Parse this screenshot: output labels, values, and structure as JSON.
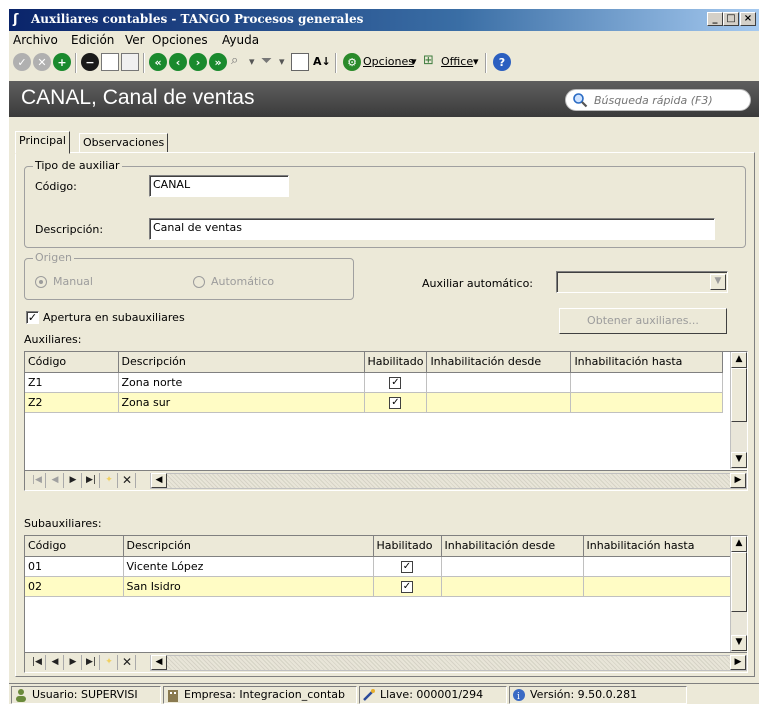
{
  "window": {
    "title": "Auxiliares contables - TANGO Procesos generales",
    "min": "_",
    "max": "□",
    "close": "×"
  },
  "menu": {
    "archivo": "Archivo",
    "edicion": "Edición",
    "ver": "Ver",
    "opciones": "Opciones",
    "ayuda": "Ayuda"
  },
  "toolbar": {
    "opciones_label": "Opciones",
    "office_label": "Office"
  },
  "header": {
    "title": "CANAL, Canal de ventas",
    "search_placeholder": "Búsqueda rápida (F3)"
  },
  "tabs": [
    {
      "label": "Principal"
    },
    {
      "label": "Observaciones"
    }
  ],
  "tipo_auxiliar": {
    "legend": "Tipo de auxiliar",
    "codigo_label": "Código:",
    "codigo_value": "CANAL",
    "descripcion_label": "Descripción:",
    "descripcion_value": "Canal de ventas"
  },
  "origen": {
    "legend": "Origen",
    "manual": "Manual",
    "automatico": "Automático"
  },
  "auxiliar_automatico_label": "Auxiliar automático:",
  "obtener_button": "Obtener auxiliares...",
  "apertura_label": "Apertura en subauxiliares",
  "auxiliares": {
    "label": "Auxiliares:",
    "columns": [
      "Código",
      "Descripción",
      "Habilitado",
      "Inhabilitación desde",
      "Inhabilitación hasta"
    ],
    "rows": [
      {
        "codigo": "Z1",
        "descripcion": "Zona norte",
        "habilitado": "✓",
        "desde": "",
        "hasta": ""
      },
      {
        "codigo": "Z2",
        "descripcion": "Zona sur",
        "habilitado": "✓",
        "desde": "",
        "hasta": ""
      }
    ]
  },
  "subauxiliares": {
    "label": "Subauxiliares:",
    "columns": [
      "Código",
      "Descripción",
      "Habilitado",
      "Inhabilitación desde",
      "Inhabilitación hasta"
    ],
    "rows": [
      {
        "codigo": "01",
        "descripcion": "Vicente López",
        "habilitado": "✓",
        "desde": "",
        "hasta": ""
      },
      {
        "codigo": "02",
        "descripcion": "San Isidro",
        "habilitado": "✓",
        "desde": "",
        "hasta": ""
      }
    ]
  },
  "status": {
    "usuario": "Usuario: SUPERVISI",
    "empresa": "Empresa: Integracion_contab",
    "llave": "Llave: 000001/294",
    "version": "Versión: 9.50.0.281"
  },
  "colors": {
    "selected_row": "#fffcc5",
    "header_bg": "#4a4a4a",
    "title_bar": "#0a246a"
  }
}
